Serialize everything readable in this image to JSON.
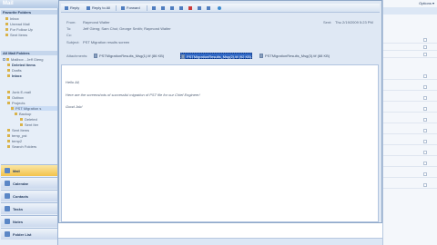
{
  "navigation": {
    "header": "Mail",
    "favorites_header": "Favorite Folders",
    "favorites": [
      "Inbox",
      "Unread Mail",
      "For Follow Up",
      "Sent Items"
    ],
    "all_folders_header": "All Mail Folders",
    "tree": [
      {
        "label": "Mailbox - Jeff Gieng",
        "level": 0,
        "bold": false
      },
      {
        "label": "Deleted Items",
        "level": 1,
        "bold": true
      },
      {
        "label": "Drafts",
        "level": 1,
        "bold": false
      },
      {
        "label": "Inbox",
        "level": 1,
        "bold": true
      },
      {
        "label": "Junk E-mail",
        "level": 1,
        "bold": false
      },
      {
        "label": "Outbox",
        "level": 1,
        "bold": false
      },
      {
        "label": "Projects",
        "level": 1,
        "bold": false
      },
      {
        "label": "PST Migration s",
        "level": 2,
        "bold": false
      },
      {
        "label": "Backup",
        "level": 3,
        "bold": false
      },
      {
        "label": "Deleted",
        "level": 4,
        "bold": false
      },
      {
        "label": "Sent Iter",
        "level": 4,
        "bold": false
      },
      {
        "label": "Sent Items",
        "level": 1,
        "bold": false
      },
      {
        "label": "temp_pst",
        "level": 1,
        "bold": false
      },
      {
        "label": "temp2",
        "level": 1,
        "bold": false
      },
      {
        "label": "Search Folders",
        "level": 1,
        "bold": false
      }
    ],
    "buttons": [
      "Mail",
      "Calendar",
      "Contacts",
      "Tasks",
      "Notes",
      "Folder List"
    ]
  },
  "toolbar": {
    "reply": "Reply",
    "reply_all": "Reply to All",
    "forward": "Forward"
  },
  "message": {
    "from_label": "From:",
    "from": "Raymond Walter",
    "to_label": "To:",
    "to": "Jeff Gieng; Sam Choi; George Smith; Raymond Walter",
    "cc_label": "Cc:",
    "cc": "",
    "subject_label": "Subject:",
    "subject": "PST Migration results screen",
    "sent_label": "Sent:",
    "sent": "Thu 2/19/2009 5:23 PM",
    "attachments_label": "Attachments:",
    "attachments": [
      "PSTMigrationResults_Msg(1).tif (86 KB)",
      "PSTMigrationResults_Msg(2).tif (92 KB)",
      "PSTMigrationResults_Msg(3).tif (88 KB)"
    ],
    "selected_attachment_index": 1,
    "body": [
      "Hello All,",
      "Here are the screenshots of successful migration of PST file for our Chief Engineer!",
      "Good Job!"
    ]
  },
  "right_pane": {
    "options_label": "Options ▾"
  }
}
